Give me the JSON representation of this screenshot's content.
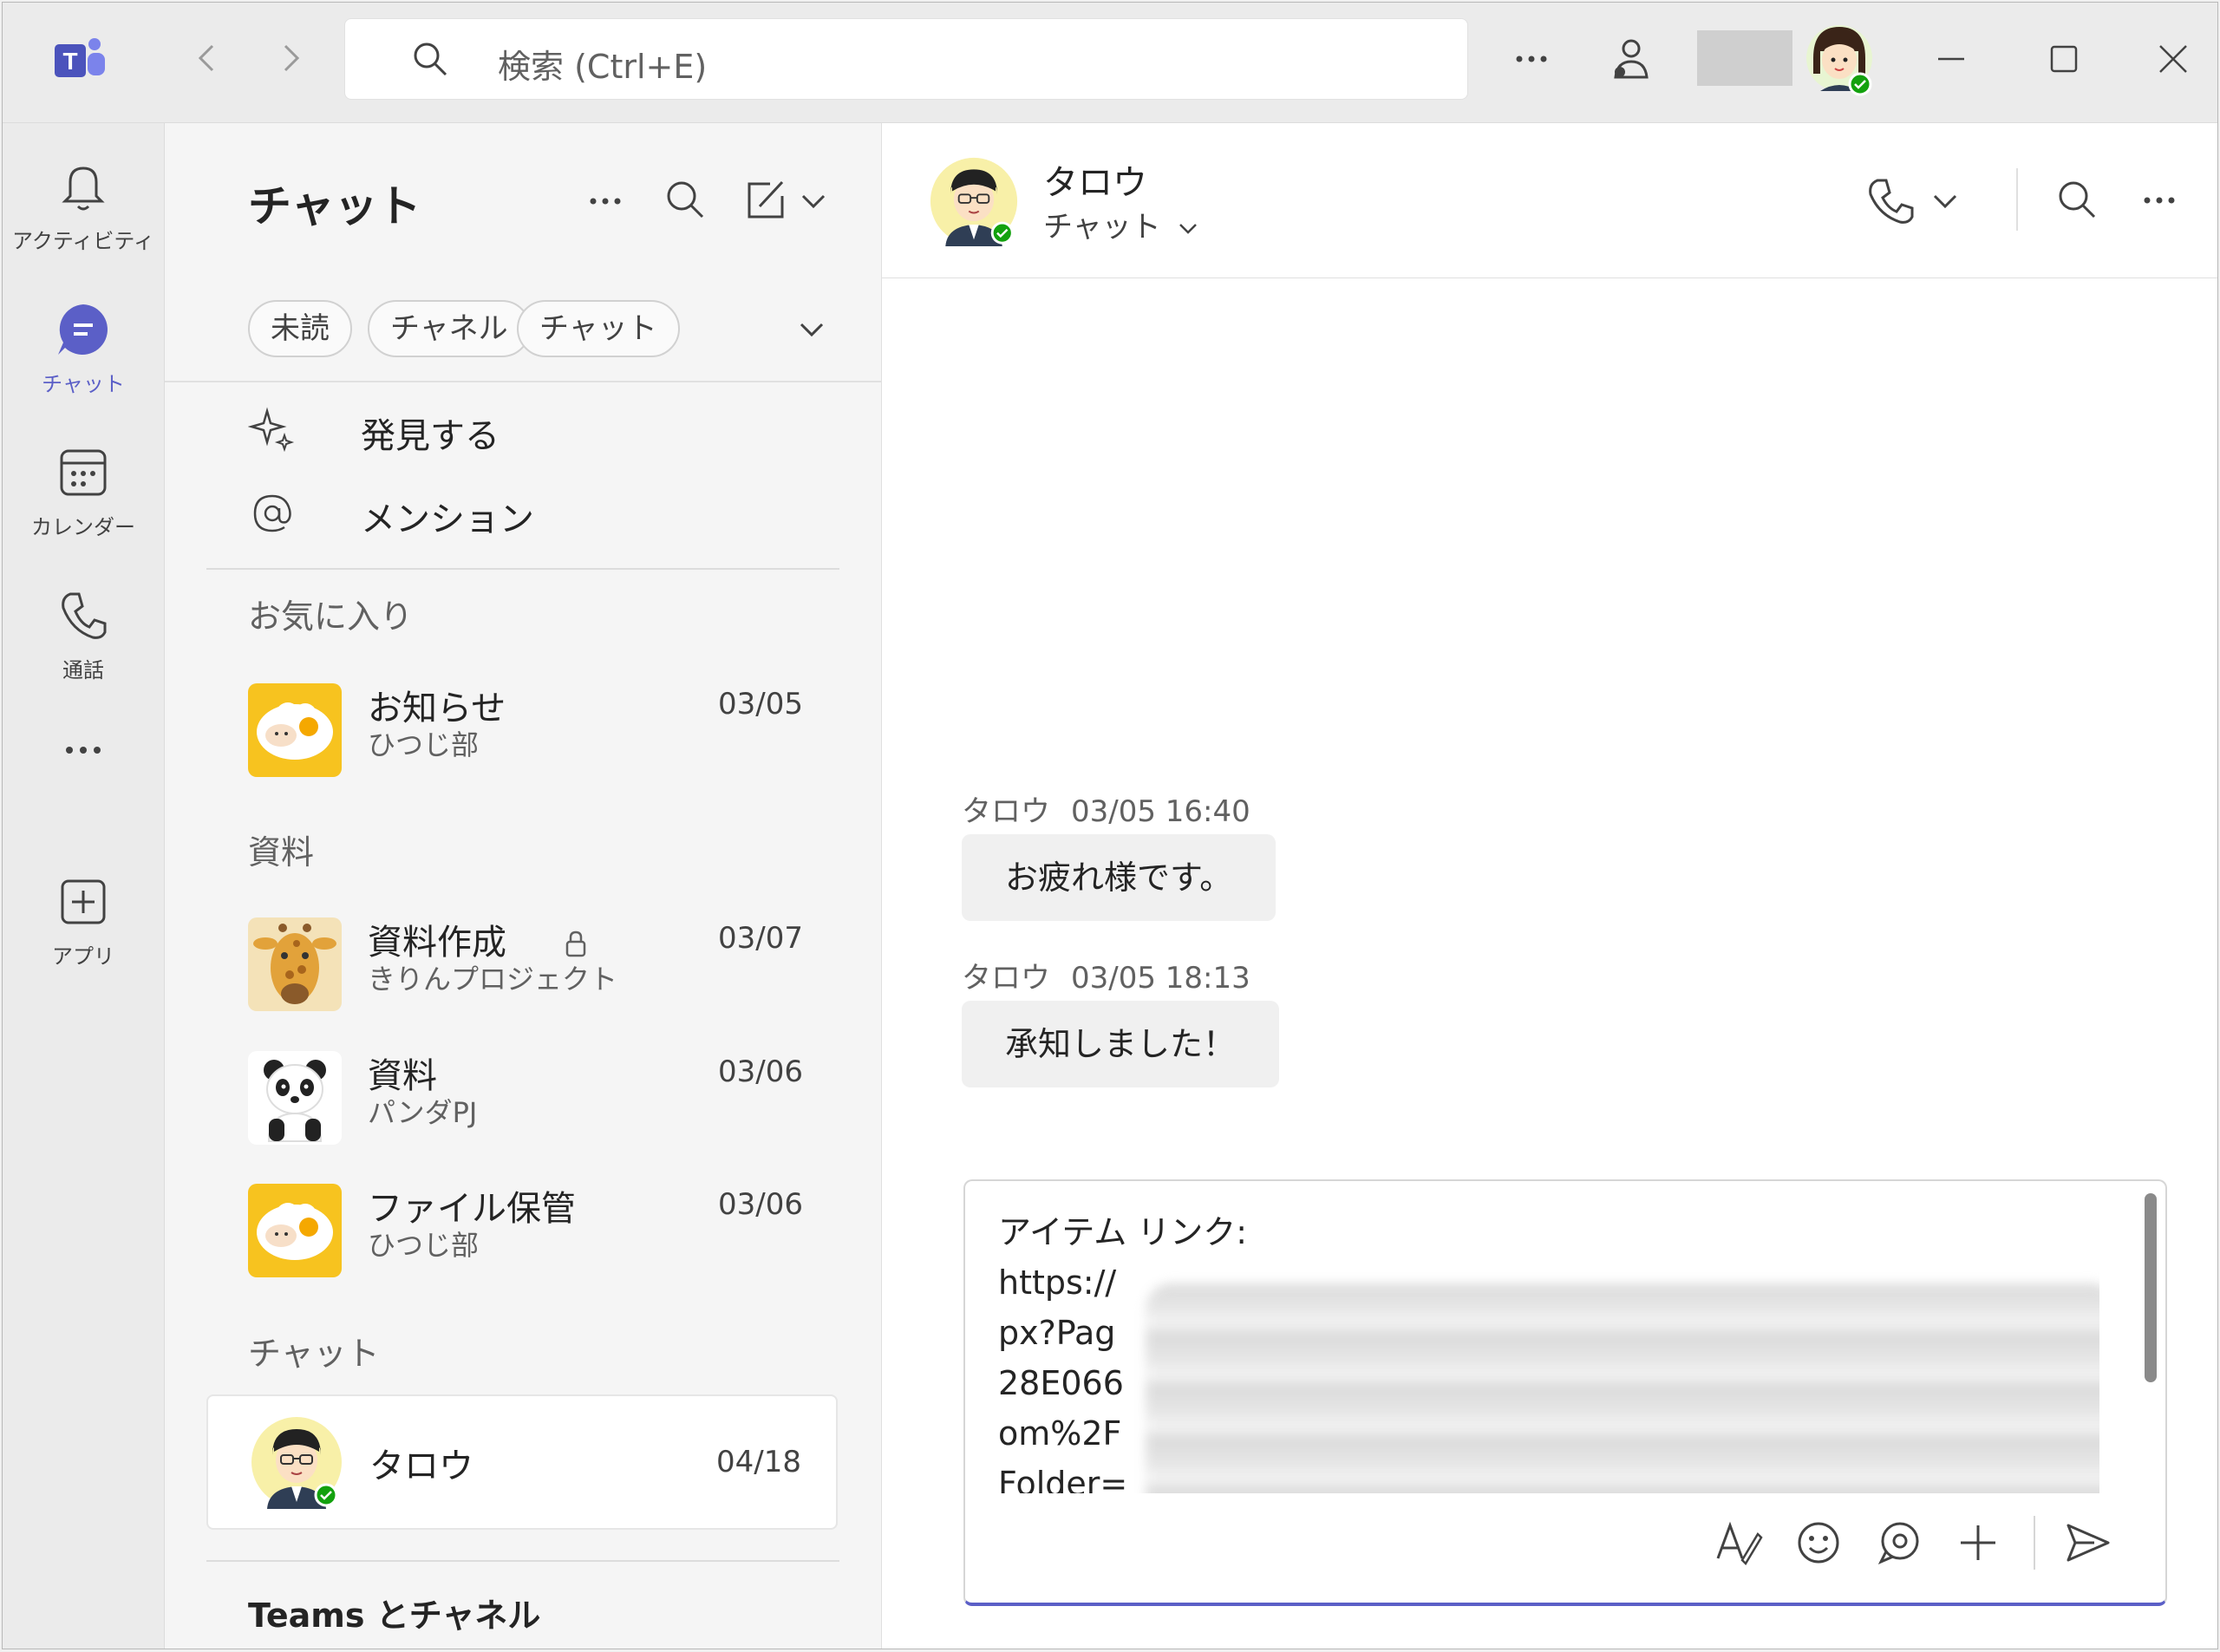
{
  "titlebar": {
    "search_placeholder": "検索 (Ctrl+E)"
  },
  "rail": {
    "items": [
      {
        "label": "アクティビティ",
        "icon": "bell-icon"
      },
      {
        "label": "チャット",
        "icon": "chat-icon",
        "active": true
      },
      {
        "label": "カレンダー",
        "icon": "calendar-icon"
      },
      {
        "label": "通話",
        "icon": "phone-icon"
      },
      {
        "label": "",
        "icon": "more-icon"
      },
      {
        "label": "アプリ",
        "icon": "add-app-icon"
      }
    ]
  },
  "chat_list": {
    "title": "チャット",
    "filters": [
      "未読",
      "チャネル",
      "チャット"
    ],
    "nav": [
      {
        "label": "発見する",
        "icon": "sparkle-icon"
      },
      {
        "label": "メンション",
        "icon": "at-icon"
      }
    ],
    "sections": [
      {
        "label": "お気に入り"
      },
      {
        "label": "資料"
      },
      {
        "label": "チャット"
      },
      {
        "label": "Teams とチャネル"
      }
    ],
    "rows": [
      {
        "name": "お知らせ",
        "sub": "ひつじ部",
        "date": "03/05",
        "avatar": "sheep"
      },
      {
        "name": "資料作成",
        "sub": "きりんプロジェクト",
        "date": "03/07",
        "avatar": "giraffe",
        "locked": true
      },
      {
        "name": "資料",
        "sub": "パンダPJ",
        "date": "03/06",
        "avatar": "panda"
      },
      {
        "name": "ファイル保管",
        "sub": "ひつじ部",
        "date": "03/06",
        "avatar": "sheep"
      },
      {
        "name": "タロウ",
        "sub": "",
        "date": "04/18",
        "avatar": "man",
        "selected": true
      }
    ]
  },
  "conversation": {
    "name": "タロウ",
    "subtitle": "チャット",
    "messages": [
      {
        "author": "タロウ",
        "time": "03/05 16:40",
        "text": "お疲れ様です。"
      },
      {
        "author": "タロウ",
        "time": "03/05 18:13",
        "text": "承知しました！"
      }
    ],
    "compose": {
      "lines": [
        "アイテム リンク:",
        "https://",
        "px?Pag",
        "28E066",
        "om%2F",
        "Folder="
      ]
    }
  },
  "colors": {
    "accent": "#5b5fc7",
    "presence": "#13a10e",
    "teams_purple": "#4b53bc"
  }
}
